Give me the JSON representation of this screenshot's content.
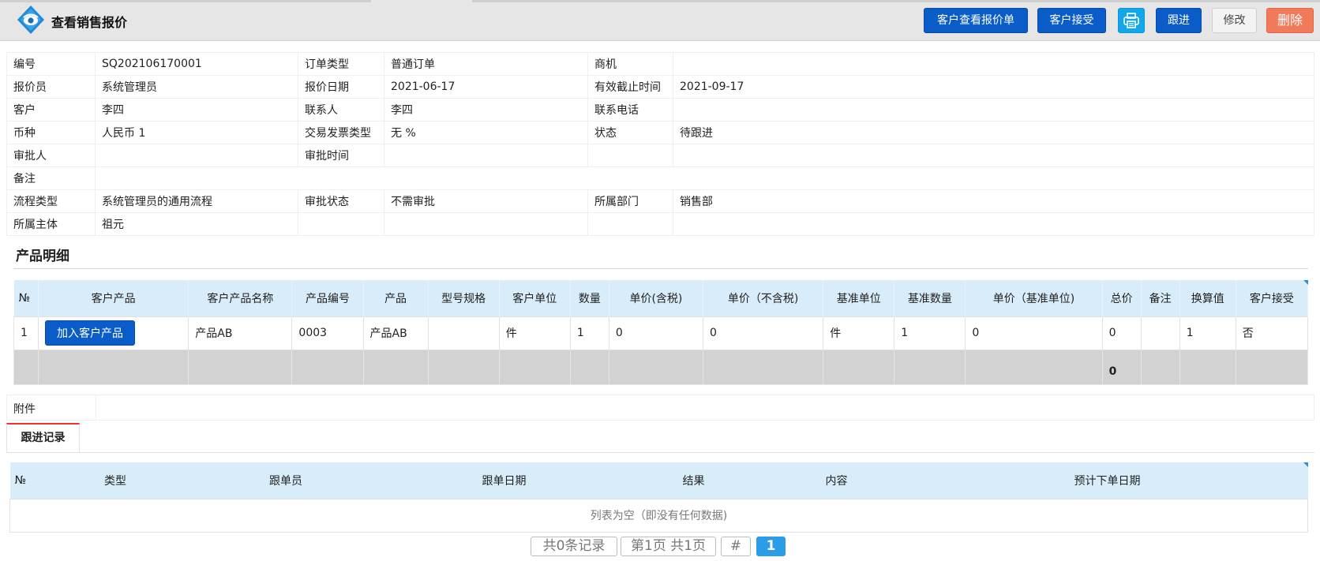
{
  "header": {
    "title": "查看销售报价",
    "buttons": {
      "customer_view": "客户查看报价单",
      "customer_accept": "客户接受",
      "follow_up": "跟进",
      "edit": "修改",
      "delete": "删除"
    }
  },
  "info": {
    "rows": [
      [
        "编号",
        "SQ202106170001",
        "订单类型",
        "普通订单",
        "商机",
        ""
      ],
      [
        "报价员",
        "系统管理员",
        "报价日期",
        "2021-06-17",
        "有效截止时间",
        "2021-09-17"
      ],
      [
        "客户",
        "李四",
        "联系人",
        "李四",
        "联系电话",
        ""
      ],
      [
        "币种",
        "人民币   1",
        "交易发票类型",
        "无   %",
        "状态",
        "待跟进"
      ],
      [
        "审批人",
        "",
        "审批时间",
        "",
        "",
        ""
      ],
      [
        "备注",
        "",
        "",
        "",
        "",
        ""
      ],
      [
        "流程类型",
        "系统管理员的通用流程",
        "审批状态",
        "不需审批",
        "所属部门",
        "销售部"
      ],
      [
        "所属主体",
        "祖元",
        "",
        "",
        "",
        ""
      ]
    ]
  },
  "products": {
    "section_title": "产品明细",
    "headers": [
      "№",
      "客户产品",
      "客户产品名称",
      "产品编号",
      "产品",
      "型号规格",
      "客户单位",
      "数量",
      "单价(含税)",
      "单价（不含税)",
      "基准单位",
      "基准数量",
      "单价（基准单位)",
      "总价",
      "备注",
      "换算值",
      "客户接受"
    ],
    "row": {
      "no": "1",
      "add_button": "加入客户产品",
      "cust_name": "产品AB",
      "code": "0003",
      "product": "产品AB",
      "spec": "",
      "cust_unit": "件",
      "qty": "1",
      "price_tax": "0",
      "price_notax": "0",
      "base_unit": "件",
      "base_qty": "1",
      "base_price": "0",
      "total": "0",
      "remark": "",
      "conv": "1",
      "accept": "否"
    },
    "sum_total": "0"
  },
  "attachment": {
    "label": "附件"
  },
  "followup": {
    "tab_label": "跟进记录",
    "headers": [
      "№",
      "类型",
      "跟单员",
      "跟单日期",
      "结果",
      "内容",
      "预计下单日期"
    ],
    "empty_text": "列表为空（即没有任何数据)"
  },
  "pager": {
    "records": "共0条记录",
    "page_info": "第1页 共1页",
    "hash": "#",
    "current": "1"
  },
  "colors": {
    "primary_button": "#0a5cc8",
    "delete_button": "#f07a5a",
    "table_header": "#d8ecfa",
    "summary_row": "#d2d2d2",
    "active_tab_border": "#e33333"
  }
}
